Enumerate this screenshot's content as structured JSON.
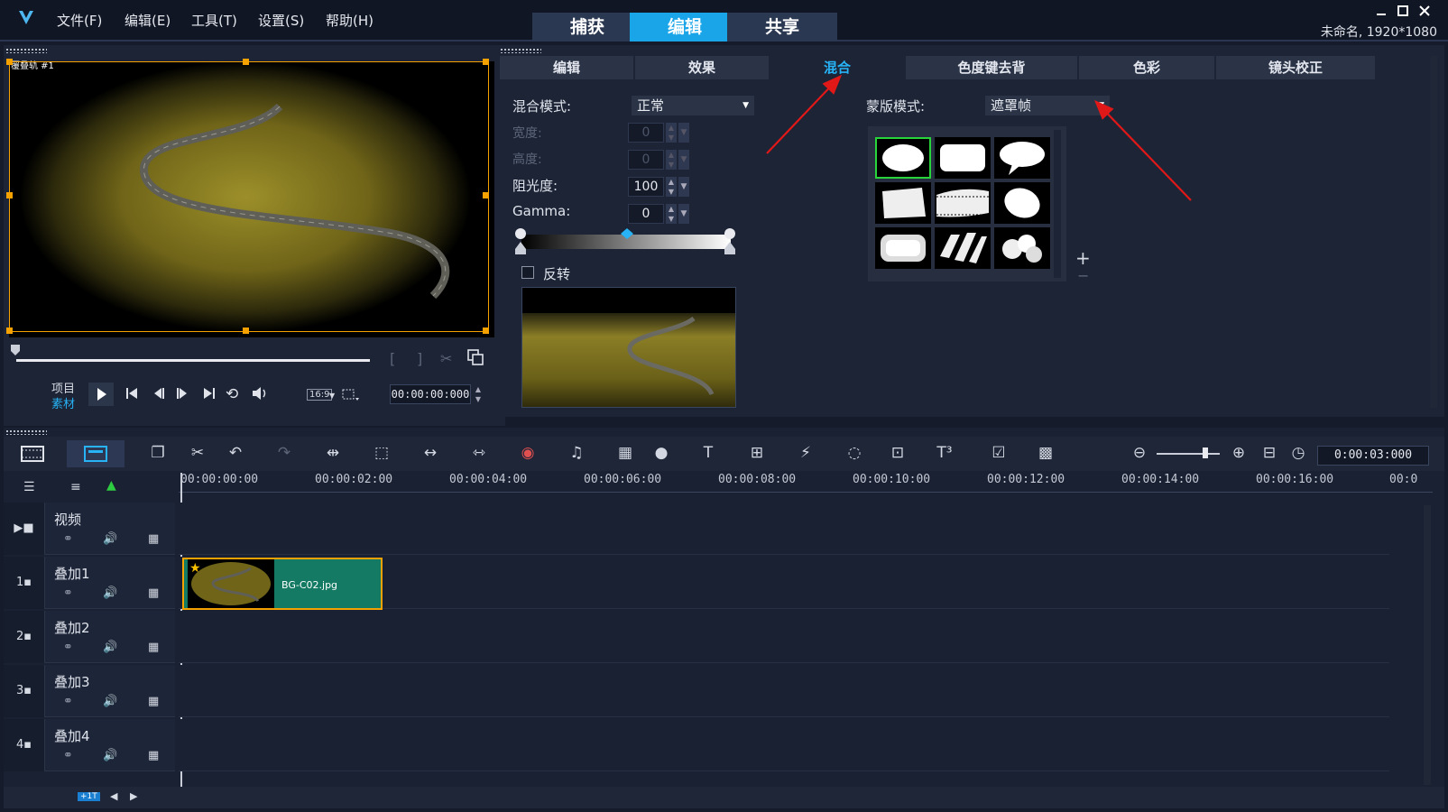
{
  "app": {
    "logo": "V",
    "menu": [
      "文件(F)",
      "编辑(E)",
      "工具(T)",
      "设置(S)",
      "帮助(H)"
    ],
    "main_tabs": [
      "捕获",
      "编辑",
      "共享"
    ],
    "active_main_tab": "编辑",
    "project_info": "未命名, 1920*1080",
    "window_controls": [
      "minimize-icon",
      "maximize-icon",
      "close-icon"
    ]
  },
  "preview": {
    "overlay_label": "覆叠轨 #1",
    "mode_project": "项目",
    "mode_clip": "素材",
    "aspect": "16:9",
    "timecode": "00:00:00:000"
  },
  "options_panel": {
    "tabs": [
      "编辑",
      "效果",
      "混合",
      "色度键去背",
      "色彩",
      "镜头校正"
    ],
    "active_tab": "混合",
    "blend_mode_label": "混合模式:",
    "blend_mode_value": "正常",
    "width_label": "宽度:",
    "width_value": "0",
    "height_label": "高度:",
    "height_value": "0",
    "opacity_label": "阻光度:",
    "opacity_value": "100",
    "gamma_label": "Gamma:",
    "gamma_value": "0",
    "invert_label": "反转",
    "mask_mode_label": "蒙版模式:",
    "mask_mode_value": "遮罩帧",
    "mask_frames": [
      "oval",
      "rounded-rect",
      "speech-bubble",
      "torn-paper",
      "film-strip",
      "soft-blob",
      "rounded-frame",
      "shards",
      "bubbles"
    ],
    "add_symbol": "+",
    "remove_symbol": "−"
  },
  "timeline": {
    "timecode": "0:00:03:000",
    "ruler": [
      "00:00:00:00",
      "00:00:02:00",
      "00:00:04:00",
      "00:00:06:00",
      "00:00:08:00",
      "00:00:10:00",
      "00:00:12:00",
      "00:00:14:00",
      "00:00:16:00",
      "00:0"
    ],
    "tracks": [
      {
        "name": "视频",
        "badge": ""
      },
      {
        "name": "叠加1",
        "badge": "1"
      },
      {
        "name": "叠加2",
        "badge": "2"
      },
      {
        "name": "叠加3",
        "badge": "3"
      },
      {
        "name": "叠加4",
        "badge": "4"
      }
    ],
    "clip": {
      "track": "叠加1",
      "filename": "BG-C02.jpg"
    },
    "footer_badge": "+1T"
  },
  "colors": {
    "accent": "#1aa5e8",
    "clip_green": "#157a63",
    "selection_orange": "#f5a100",
    "annotation_red": "#e01818"
  }
}
